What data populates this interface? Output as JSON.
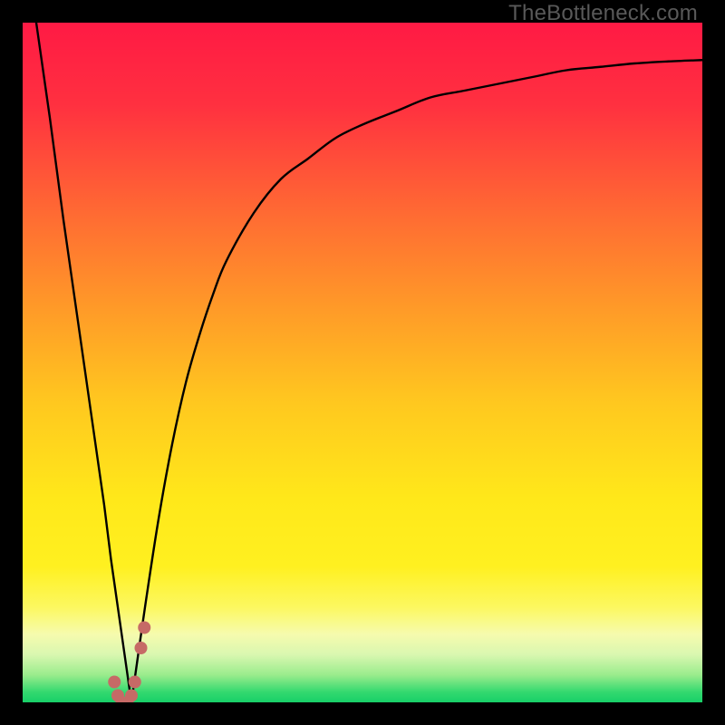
{
  "watermark": "TheBottleneck.com",
  "colors": {
    "frame": "#000000",
    "curve": "#000000",
    "dot_fill": "#c66a66",
    "gradient_stops": [
      {
        "offset": 0.0,
        "color": "#ff1a44"
      },
      {
        "offset": 0.12,
        "color": "#ff3040"
      },
      {
        "offset": 0.28,
        "color": "#ff6a33"
      },
      {
        "offset": 0.42,
        "color": "#ff9a28"
      },
      {
        "offset": 0.56,
        "color": "#ffc81f"
      },
      {
        "offset": 0.7,
        "color": "#ffe81a"
      },
      {
        "offset": 0.8,
        "color": "#fff020"
      },
      {
        "offset": 0.86,
        "color": "#fcf860"
      },
      {
        "offset": 0.9,
        "color": "#f6fbae"
      },
      {
        "offset": 0.93,
        "color": "#d9f7b0"
      },
      {
        "offset": 0.96,
        "color": "#99ec8c"
      },
      {
        "offset": 0.985,
        "color": "#33d96f"
      },
      {
        "offset": 1.0,
        "color": "#18cf68"
      }
    ]
  },
  "chart_data": {
    "type": "line",
    "title": "",
    "xlabel": "",
    "ylabel": "",
    "xlim": [
      0,
      100
    ],
    "ylim": [
      0,
      100
    ],
    "x": [
      2,
      4,
      6,
      8,
      10,
      11,
      12,
      13,
      14,
      15,
      16,
      18,
      20,
      22,
      24,
      26,
      28,
      30,
      34,
      38,
      42,
      46,
      50,
      55,
      60,
      65,
      70,
      75,
      80,
      85,
      90,
      95,
      100
    ],
    "series": [
      {
        "name": "left-branch",
        "values": [
          100,
          86,
          71,
          57,
          43,
          36,
          29,
          21,
          14,
          7,
          0,
          null,
          null,
          null,
          null,
          null,
          null,
          null,
          null,
          null,
          null,
          null,
          null,
          null,
          null,
          null,
          null,
          null,
          null,
          null,
          null,
          null,
          null
        ]
      },
      {
        "name": "right-branch",
        "values": [
          null,
          null,
          null,
          null,
          null,
          null,
          null,
          null,
          null,
          null,
          0,
          14,
          27,
          38,
          47,
          54,
          60,
          65,
          72,
          77,
          80,
          83,
          85,
          87,
          89,
          90,
          91,
          92,
          93,
          93.5,
          94,
          94.3,
          94.5
        ]
      }
    ],
    "dots": {
      "name": "highlight-dots",
      "points": [
        {
          "x": 13.5,
          "y": 3
        },
        {
          "x": 14.0,
          "y": 1
        },
        {
          "x": 14.6,
          "y": 0
        },
        {
          "x": 15.4,
          "y": 0
        },
        {
          "x": 16.0,
          "y": 1
        },
        {
          "x": 16.5,
          "y": 3
        },
        {
          "x": 17.4,
          "y": 8
        },
        {
          "x": 17.9,
          "y": 11
        }
      ],
      "radius_px": 7
    }
  }
}
